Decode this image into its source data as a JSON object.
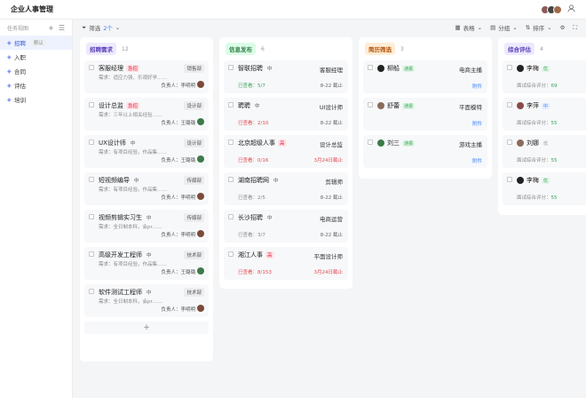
{
  "app_title": "企业人事管理",
  "sidebar": {
    "header": "任务视图",
    "items": [
      {
        "label": "招聘",
        "tag": "默认",
        "active": true
      },
      {
        "label": "入职"
      },
      {
        "label": "合同"
      },
      {
        "label": "评估"
      },
      {
        "label": "培训"
      }
    ]
  },
  "toolbar": {
    "filter_label": "筛选",
    "filter_count": "2个",
    "table_label": "表格",
    "group_label": "分组",
    "sort_label": "排序"
  },
  "columns": [
    {
      "title": "招聘需求",
      "count": "12",
      "color": "#ede9fe",
      "text_color": "#5b3fb8",
      "cards": [
        {
          "title": "客服经理",
          "priority": "急招",
          "dept": "销售部",
          "req": "需求：适应力强、乐观好学……",
          "owner": "负责人：李明明"
        },
        {
          "title": "设计总监",
          "priority": "急招",
          "dept": "设计部",
          "req": "需求：三年以上相关经验……",
          "owner": "负责人：王璐璐"
        },
        {
          "title": "UX设计师",
          "priority": "中",
          "dept": "设计部",
          "req": "需求：有项目经验，作品集……",
          "owner": "负责人：王璐璐"
        },
        {
          "title": "短视频编导",
          "priority": "中",
          "dept": "传媒部",
          "req": "需求：有项目经验，作品集……",
          "owner": "负责人：李明明"
        },
        {
          "title": "视频剪辑实习生",
          "priority": "中",
          "dept": "传媒部",
          "req": "需求：全日制本科，会pr……",
          "owner": "负责人：李明明"
        },
        {
          "title": "高级开发工程师",
          "priority": "中",
          "dept": "技术部",
          "req": "需求：有项目经验，作品集……",
          "owner": "负责人：王璐璐"
        },
        {
          "title": "软件测试工程师",
          "priority": "中",
          "dept": "技术部",
          "req": "需求：全日制本科，会pr……",
          "owner": "负责人：李明明"
        }
      ],
      "add": "+"
    },
    {
      "title": "信息发布",
      "count": "6",
      "color": "#dcfce7",
      "text_color": "#2f7d46",
      "cards": [
        {
          "title": "智联招聘",
          "priority": "中",
          "pos": "客服经理",
          "viewed": "已查看：5/7",
          "ddl": "8-22 截止"
        },
        {
          "title": "聘聘",
          "priority": "中",
          "pos": "UI设计师",
          "viewed": "已查看：2/10",
          "ddl": "8-22 截止"
        },
        {
          "title": "北京超级人事",
          "priority": "高",
          "pos": "设计总监",
          "viewed": "已查看：0/16",
          "ddl": "3月24日截止"
        },
        {
          "title": "湖南招聘网",
          "priority": "中",
          "pos": "剪辑师",
          "viewed": "已查看：2/5",
          "ddl": "8-22 截止"
        },
        {
          "title": "长沙招聘",
          "priority": "中",
          "pos": "电商运营",
          "viewed": "已查看：3/7",
          "ddl": "8-22 截止"
        },
        {
          "title": "湘江人事",
          "priority": "高",
          "pos": "平面设计师",
          "viewed": "已查看：8/153",
          "ddl": "3月24日截止"
        }
      ]
    },
    {
      "title": "简历筛选",
      "count": "3",
      "color": "#ffedd5",
      "text_color": "#b45309",
      "cards": [
        {
          "name": "柳船",
          "status": "通报",
          "pos": "电商主播",
          "attach": "附件"
        },
        {
          "name": "舒蕾",
          "status": "通报",
          "pos": "平面模特",
          "attach": "附件"
        },
        {
          "name": "刘三",
          "status": "通报",
          "pos": "游戏主播",
          "attach": "附件"
        }
      ]
    },
    {
      "title": "综合评估",
      "count": "4",
      "color": "#ede9fe",
      "text_color": "#5b3fb8",
      "cards": [
        {
          "name": "李梅",
          "status": "优",
          "score_label": "面试综合评分：",
          "score": "69"
        },
        {
          "name": "李萍",
          "status": "中",
          "score_label": "面试综合评分：",
          "score": "55"
        },
        {
          "name": "刘娜",
          "status": "低",
          "score_label": "面试综合评分：",
          "score": "55"
        },
        {
          "name": "李梅",
          "status": "优",
          "score_label": "面试综合评分：",
          "score": "55"
        }
      ]
    }
  ]
}
